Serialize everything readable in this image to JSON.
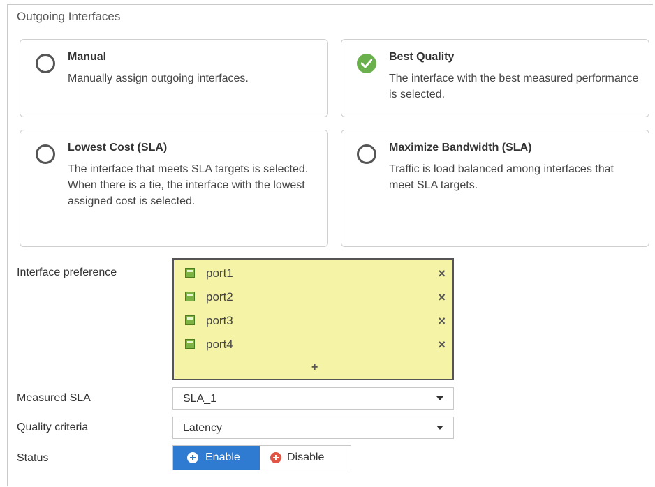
{
  "section": {
    "title": "Outgoing Interfaces"
  },
  "options": [
    {
      "title": "Manual",
      "description": "Manually assign outgoing interfaces.",
      "selected": false
    },
    {
      "title": "Best Quality",
      "description": "The interface with the best measured performance is selected.",
      "selected": true
    },
    {
      "title": "Lowest Cost (SLA)",
      "description": "The interface that meets SLA targets is selected. When there is a tie, the interface with the lowest assigned cost is selected.",
      "selected": false
    },
    {
      "title": "Maximize Bandwidth (SLA)",
      "description": "Traffic is load balanced among interfaces that meet SLA targets.",
      "selected": false
    }
  ],
  "interface_preference": {
    "label": "Interface preference",
    "ports": [
      "port1",
      "port2",
      "port3",
      "port4"
    ],
    "remove_icon": "×",
    "add_icon": "+"
  },
  "measured_sla": {
    "label": "Measured SLA",
    "value": "SLA_1"
  },
  "quality_criteria": {
    "label": "Quality criteria",
    "value": "Latency"
  },
  "status": {
    "label": "Status",
    "enable_label": "Enable",
    "disable_label": "Disable",
    "selected": "Enable"
  },
  "colors": {
    "accent": "#2f7bd1",
    "check": "#6ab04c",
    "highlight": "#f5f3a6",
    "disable": "#e05545"
  }
}
